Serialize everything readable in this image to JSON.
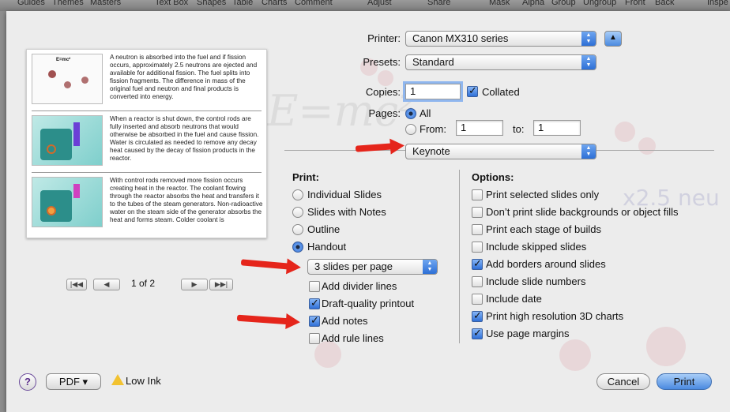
{
  "toolbar": {
    "items": [
      "Guides",
      "Themes",
      "Masters",
      "Text Box",
      "Shapes",
      "Table",
      "Charts",
      "Comment",
      "Adjust",
      "Share",
      "Mask",
      "Alpha",
      "Group",
      "Ungroup",
      "Front",
      "Back",
      "Inspe"
    ]
  },
  "printer": {
    "label": "Printer:",
    "value": "Canon MX310 series"
  },
  "presets": {
    "label": "Presets:",
    "value": "Standard"
  },
  "copies": {
    "label": "Copies:",
    "value": "1",
    "collated_label": "Collated",
    "collated": true
  },
  "pages": {
    "label": "Pages:",
    "all_label": "All",
    "from_label": "From:",
    "from_value": "1",
    "to_label": "to:",
    "to_value": "1",
    "selected": "All"
  },
  "section_popup": {
    "value": "Keynote"
  },
  "print_group": {
    "title": "Print:",
    "options": [
      "Individual Slides",
      "Slides with Notes",
      "Outline",
      "Handout"
    ],
    "selected": "Handout",
    "handout_popup": "3 slides per page",
    "checks": [
      {
        "label": "Add divider lines",
        "checked": false
      },
      {
        "label": "Draft-quality printout",
        "checked": true
      },
      {
        "label": "Add notes",
        "checked": true
      },
      {
        "label": "Add rule lines",
        "checked": false
      }
    ]
  },
  "options_group": {
    "title": "Options:",
    "checks": [
      {
        "label": "Print selected slides only",
        "checked": false
      },
      {
        "label": "Don’t print slide backgrounds or object fills",
        "checked": false
      },
      {
        "label": "Print each stage of builds",
        "checked": false
      },
      {
        "label": "Include skipped slides",
        "checked": false
      },
      {
        "label": "Add borders around slides",
        "checked": true
      },
      {
        "label": "Include slide numbers",
        "checked": false
      },
      {
        "label": "Include date",
        "checked": false
      },
      {
        "label": "Print high resolution 3D charts",
        "checked": true
      },
      {
        "label": "Use page margins",
        "checked": true
      }
    ]
  },
  "preview": {
    "page_indicator": "1 of 2",
    "slide1_title": "E=mc²",
    "notes": [
      "A neutron is absorbed into the fuel and if fission occurs, approximately 2.5 neutrons are ejected and available for additional fission. The fuel splits into fission fragments. The difference in mass of the original fuel and neutron and final products is converted into energy.",
      "When a reactor is shut down, the control rods are fully inserted and absorb neutrons that would otherwise be absorbed in the fuel and cause fission. Water is circulated as needed to remove any decay heat caused by the decay of fission products in the reactor.",
      "With control rods removed more fission occurs creating heat in the reactor.  The coolant flowing through the reactor absorbs the heat and transfers it to the tubes of the steam generators. Non-radioactive water on the steam side of the generator absorbs the heat and forms steam. Colder coolant is"
    ]
  },
  "footer": {
    "help": "?",
    "pdf": "PDF ▾",
    "low_ink": "Low Ink",
    "cancel": "Cancel",
    "print": "Print"
  },
  "background": {
    "watermark": "E=mc²",
    "watermark2": "x2.5 neu"
  },
  "colors": {
    "accent": "#2f6fd6",
    "arrow": "#e5251b",
    "sheet": "#ececec"
  }
}
